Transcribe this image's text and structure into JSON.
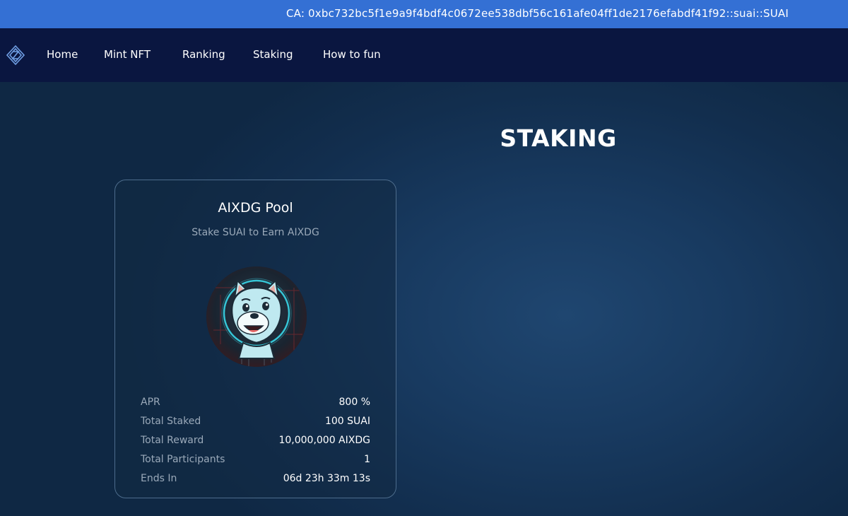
{
  "topbar": {
    "contract_address": "CA: 0xbc732bc5f1e9a9f4bdf4c0672ee538dbf56c161afe04ff1de2176efabdf41f92::suai::SUAI"
  },
  "nav": {
    "items": [
      {
        "label": "Home"
      },
      {
        "label": "Mint NFT"
      },
      {
        "label": "Ranking"
      },
      {
        "label": "Staking"
      },
      {
        "label": "How to fun"
      }
    ]
  },
  "page": {
    "title": "STAKING"
  },
  "pool": {
    "name": "AIXDG Pool",
    "subtitle": "Stake SUAI to Earn AIXDG",
    "stats": [
      {
        "label": "APR",
        "value": "800 %"
      },
      {
        "label": "Total Staked",
        "value": "100 SUAI"
      },
      {
        "label": "Total Reward",
        "value": "10,000,000 AIXDG"
      },
      {
        "label": "Total Participants",
        "value": "1"
      },
      {
        "label": "Ends In",
        "value": "06d 23h 33m 13s"
      }
    ]
  },
  "colors": {
    "topbar": "#3470d4",
    "navbar": "#0a1640",
    "background": "#183a60",
    "accent_cyan": "#38d6e8"
  }
}
